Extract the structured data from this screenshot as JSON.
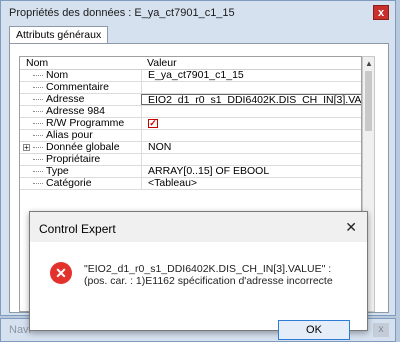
{
  "window": {
    "title": "Propriétés des données : E_ya_ct7901_c1_15",
    "close_glyph": "x"
  },
  "tabs": [
    {
      "label": "Attributs généraux"
    }
  ],
  "grid": {
    "headers": {
      "name": "Nom",
      "value": "Valeur"
    },
    "rows": [
      {
        "name": "Nom",
        "value": "E_ya_ct7901_c1_15"
      },
      {
        "name": "Commentaire",
        "value": ""
      },
      {
        "name": "Adresse",
        "value": "EIO2_d1_r0_s1_DDI6402K.DIS_CH_IN[3].VALUE"
      },
      {
        "name": "Adresse 984",
        "value": ""
      },
      {
        "name": "R/W Programme",
        "value": ""
      },
      {
        "name": "Alias pour",
        "value": ""
      },
      {
        "name": "Donnée globale",
        "value": "NON"
      },
      {
        "name": "Propriétaire",
        "value": ""
      },
      {
        "name": "Type",
        "value": "ARRAY[0..15] OF EBOOL"
      },
      {
        "name": "Catégorie",
        "value": "<Tableau>"
      }
    ],
    "expand_glyph": "+",
    "scroll_up_glyph": "▲"
  },
  "dialog": {
    "title": "Control Expert",
    "close_glyph": "✕",
    "icon_glyph": "✕",
    "message": "\"EIO2_d1_r0_s1_DDI6402K.DIS_CH_IN[3].VALUE\" : (pos. car. : 1)E1162 spécification d'adresse incorrecte",
    "ok_label": "OK"
  },
  "background_window": {
    "title": "Navi",
    "close_glyph": "x"
  },
  "colors": {
    "error_red": "#e2322b",
    "ok_border": "#2d7cd6",
    "frame_blue": "#d5e1ef"
  }
}
